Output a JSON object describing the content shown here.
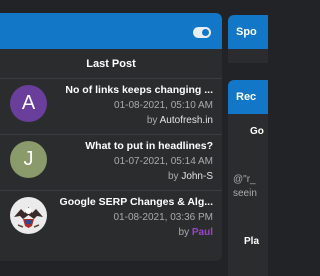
{
  "last_post_panel": {
    "column_title": "Last Post",
    "posts": [
      {
        "avatar_letter": "A",
        "title": "No of links keeps changing ...",
        "date": "01-08-2021, 05:10 AM",
        "by_prefix": "by",
        "author": "Autofresh.in"
      },
      {
        "avatar_letter": "J",
        "title": "What to put in headlines?",
        "date": "01-07-2021, 05:14 AM",
        "by_prefix": "by",
        "author": "John-S"
      },
      {
        "avatar_icon": "eagle-avatar-icon",
        "title": "Google SERP Changes & Alg...",
        "date": "01-08-2021, 03:36 PM",
        "by_prefix": "by",
        "author": "Paul"
      }
    ]
  },
  "right_widgets": {
    "sponsor_head": "Spo",
    "recent_head": "Rec",
    "recent_item1": "Go",
    "recent_item2": "@\"r_",
    "recent_item3": "seein",
    "recent_item4": "Pla"
  },
  "colors": {
    "accent": "#1377c7",
    "moderator_name": "#9b44c7"
  }
}
